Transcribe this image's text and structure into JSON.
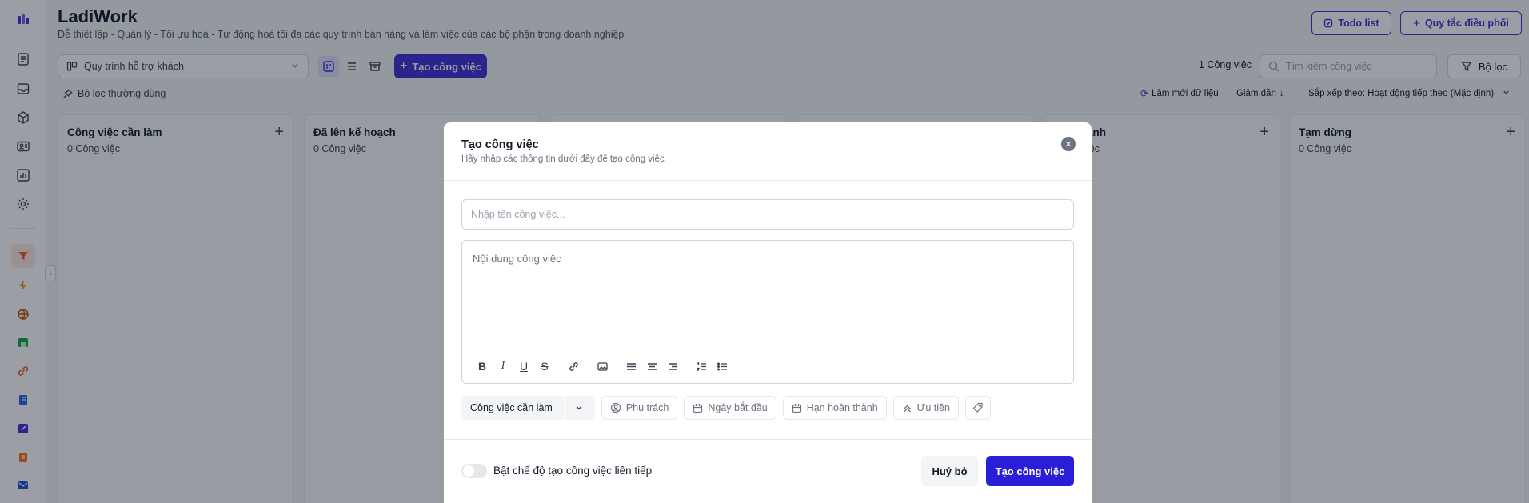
{
  "header": {
    "title": "LadiWork",
    "subtitle": "Dễ thiết lập - Quản lý - Tối ưu hoá - Tự động hoá tối đa các quy trình bán hàng và làm việc của các bộ phận trong doanh nghiệp",
    "todo_label": "Todo list",
    "rules_label": "Quy tắc điều phối"
  },
  "toolbar": {
    "pipeline_select": "Quy trình hỗ trợ khách",
    "create_label": "Tạo công việc",
    "count_label": "1 Công việc",
    "search_placeholder": "Tìm kiếm công việc",
    "filter_label": "Bộ lọc",
    "pinned_filter_label": "Bộ lọc thường dùng",
    "refresh_label": "Làm mới dữ liệu",
    "order_label": "Giảm dần",
    "sort_label": "Sắp xếp theo: Hoạt động tiếp theo (Mặc định)"
  },
  "columns": [
    {
      "title": "Công việc cần làm",
      "count": "0 Công việc"
    },
    {
      "title": "Đã lên kế hoạch",
      "count": "0 Công việc"
    },
    {
      "title": "",
      "count": ""
    },
    {
      "title": "",
      "count": ""
    },
    {
      "title": "ành",
      "count": "iệc"
    },
    {
      "title": "Tạm dừng",
      "count": "0 Công việc"
    }
  ],
  "modal": {
    "title": "Tạo công việc",
    "subtitle": "Hãy nhập các thông tin dưới đây để tạo công việc",
    "name_placeholder": "Nhập tên công việc...",
    "content_placeholder": "Nội dung công việc",
    "status_value": "Công việc cần làm",
    "assignee_placeholder": "Phụ trách",
    "start_date_placeholder": "Ngày bắt đầu",
    "due_date_placeholder": "Hạn hoàn thành",
    "priority_placeholder": "Ưu tiên",
    "continuous_label": "Bật chế độ tạo công việc liên tiếp",
    "cancel_label": "Huỷ bỏ",
    "submit_label": "Tạo công việc"
  },
  "colors": {
    "accent": "#3b2fd6",
    "submit": "#2a1ed8",
    "overlay": "rgba(17,24,39,0.42)"
  }
}
